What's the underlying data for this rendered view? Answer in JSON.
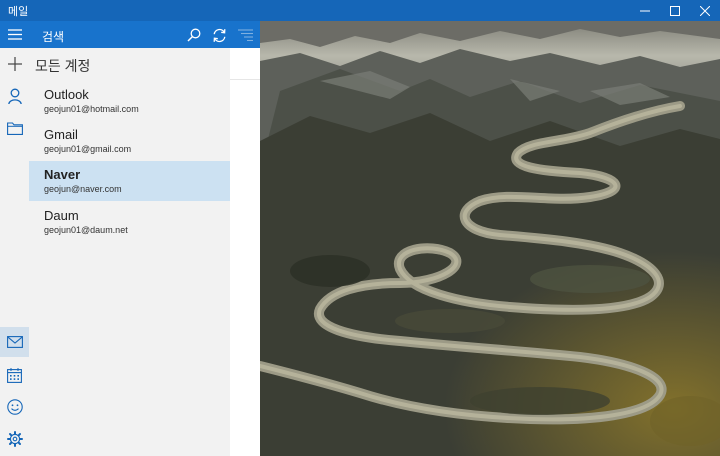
{
  "window": {
    "title": "메일"
  },
  "search": {
    "label": "검색"
  },
  "accounts_header": "모든 계정",
  "accounts": [
    {
      "name": "Outlook",
      "email": "geojun01@hotmail.com",
      "selected": false
    },
    {
      "name": "Gmail",
      "email": "geojun01@gmail.com",
      "selected": false
    },
    {
      "name": "Naver",
      "email": "geojun@naver.com",
      "selected": true
    },
    {
      "name": "Daum",
      "email": "geojun01@daum.net",
      "selected": false
    }
  ],
  "icons": {
    "rail_top": [
      "menu-icon",
      "add-icon",
      "person-icon",
      "folder-icon"
    ],
    "rail_bottom": [
      "mail-icon",
      "calendar-icon",
      "emoji-icon",
      "settings-icon"
    ],
    "search_bar": [
      "search-icon",
      "sync-icon",
      "filter-icon"
    ]
  },
  "colors": {
    "titlebar": "#1566b8",
    "accent": "#1873cc",
    "pane": "#f2f2f2",
    "selected": "#cce1f2"
  }
}
